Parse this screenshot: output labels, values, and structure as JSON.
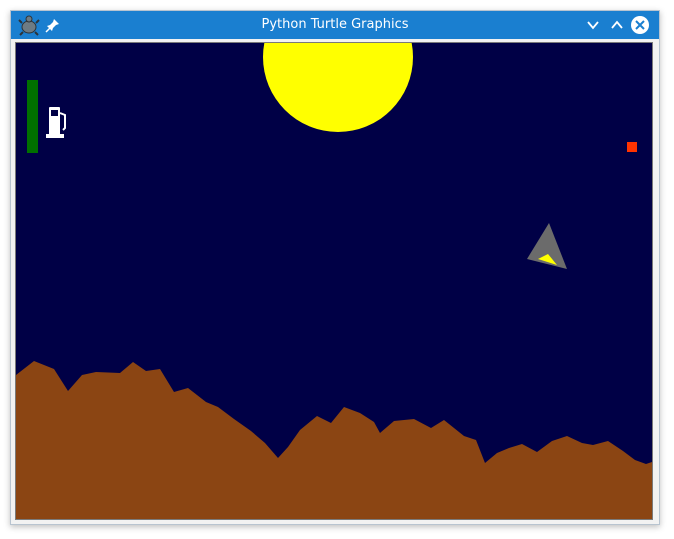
{
  "window": {
    "title": "Python Turtle Graphics",
    "titlebar_color": "#1a7fd0"
  },
  "titlebar_buttons": {
    "minimize_icon": "chevron-down-icon",
    "maximize_icon": "chevron-up-icon",
    "close_icon": "close-circle-icon"
  },
  "game": {
    "sky_color": "#000046",
    "moon_color": "#ffff00",
    "terrain_color": "#8b4513",
    "fuel_gauge_color": "#007000",
    "fuel_icon": "fuel-pump-icon",
    "target_marker_color": "#ff3300",
    "lander_color": "#6b6b6b",
    "thruster_flame_color": "#ffff00"
  }
}
